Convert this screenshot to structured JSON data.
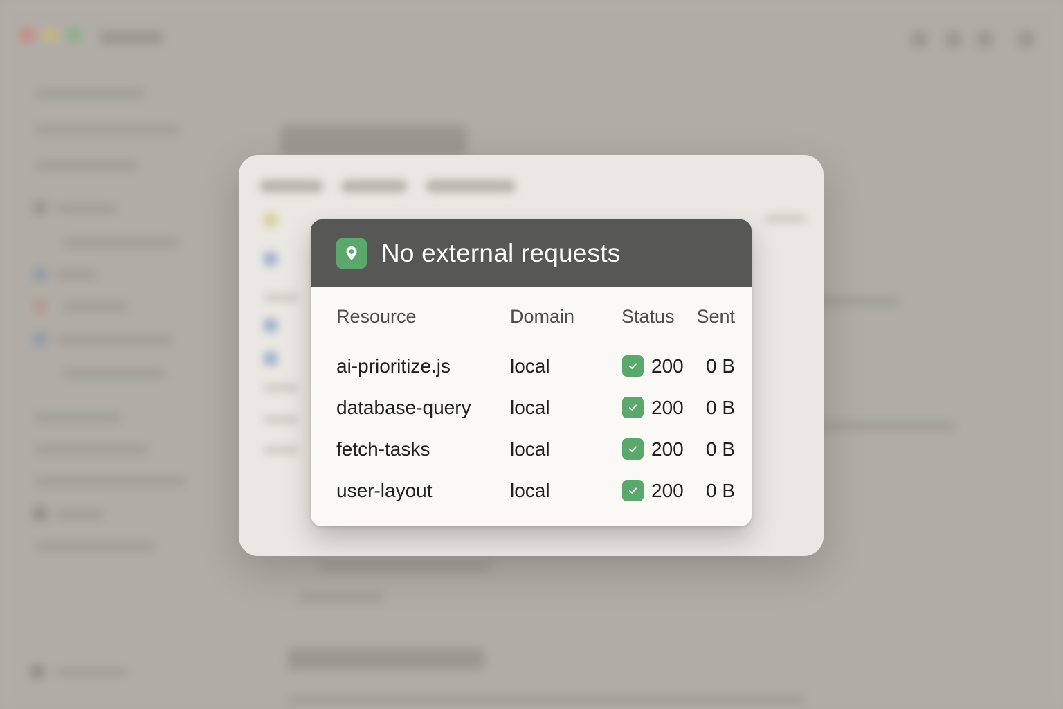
{
  "dialog": {
    "title": "No external requests",
    "icon": "location-pin-icon",
    "accent_color": "#5ba86d",
    "header_color": "#575755",
    "columns": {
      "resource": "Resource",
      "domain": "Domain",
      "status": "Status",
      "sent": "Sent"
    },
    "rows": [
      {
        "resource": "ai-prioritize.js",
        "domain": "local",
        "status": "200",
        "sent": "0 B",
        "status_icon": "check-icon"
      },
      {
        "resource": "database-query",
        "domain": "local",
        "status": "200",
        "sent": "0 B",
        "status_icon": "check-icon"
      },
      {
        "resource": "fetch-tasks",
        "domain": "local",
        "status": "200",
        "sent": "0 B",
        "status_icon": "check-icon"
      },
      {
        "resource": "user-layout",
        "domain": "local",
        "status": "200",
        "sent": "0 B",
        "status_icon": "check-icon"
      }
    ]
  }
}
